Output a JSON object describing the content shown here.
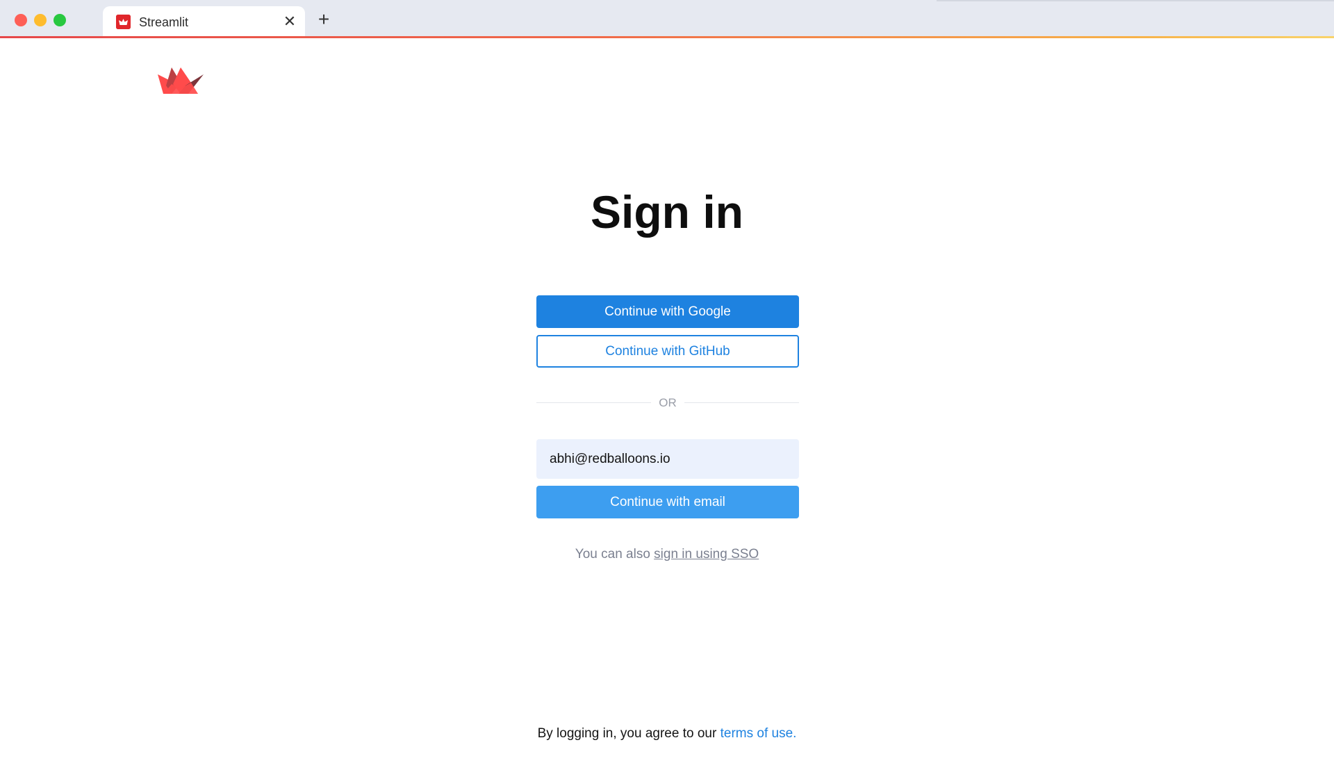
{
  "browser": {
    "tab": {
      "title": "Streamlit",
      "close_glyph": "✕",
      "favicon": "streamlit-logo-icon"
    },
    "new_tab_glyph": "+",
    "colors": {
      "chrome": "#e6e9f1",
      "close_dot": "#fe5f57",
      "minimize_dot": "#febc2e",
      "maximize_dot": "#28c840"
    }
  },
  "page": {
    "logo": "streamlit-crown-logo",
    "title": "Sign in",
    "google_button": "Continue with Google",
    "github_button": "Continue with GitHub",
    "divider_text": "OR",
    "email": {
      "value": "abhi@redballoons.io",
      "placeholder": ""
    },
    "email_button": "Continue with email",
    "sso": {
      "prefix": "You can also ",
      "link": "sign in using SSO"
    },
    "terms": {
      "prefix": "By logging in, you agree to our ",
      "link": "terms of use."
    },
    "colors": {
      "primary": "#1e82e0",
      "email_button": "#3d9ef0",
      "input_bg": "#ebf1fd",
      "brand_red": "#ff4b4b"
    }
  }
}
